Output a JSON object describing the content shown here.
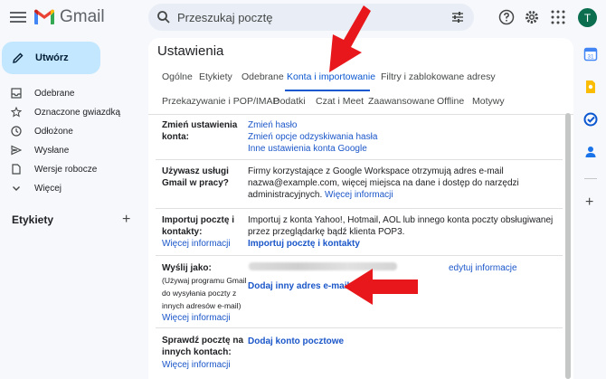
{
  "app": {
    "name": "Gmail",
    "avatar_letter": "T"
  },
  "search": {
    "placeholder": "Przeszukaj pocztę"
  },
  "sidebar": {
    "compose_label": "Utwórz",
    "items": [
      {
        "label": "Odebrane",
        "icon": "inbox-icon"
      },
      {
        "label": "Oznaczone gwiazdką",
        "icon": "star-icon"
      },
      {
        "label": "Odłożone",
        "icon": "clock-icon"
      },
      {
        "label": "Wysłane",
        "icon": "send-icon"
      },
      {
        "label": "Wersje robocze",
        "icon": "draft-icon"
      },
      {
        "label": "Więcej",
        "icon": "chevron-down-icon"
      }
    ],
    "labels_title": "Etykiety"
  },
  "settings": {
    "title": "Ustawienia",
    "tabs_row1": [
      "Ogólne",
      "Etykiety",
      "Odebrane",
      "Konta i importowanie",
      "Filtry i zablokowane adresy"
    ],
    "tabs_row2": [
      "Przekazywanie i POP/IMAP",
      "Dodatki",
      "Czat i Meet",
      "Zaawansowane",
      "Offline",
      "Motywy"
    ],
    "active_tab": "Konta i importowanie",
    "rows": {
      "change_account": {
        "label_line1": "Zmień ustawienia",
        "label_line2": "konta:",
        "links": [
          "Zmień hasło",
          "Zmień opcje odzyskiwania hasła",
          "Inne ustawienia konta Google"
        ]
      },
      "workspace": {
        "label_line1": "Używasz usługi",
        "label_line2": "Gmail w pracy?",
        "text_line1": "Firmy korzystające z Google Workspace otrzymują adres e-mail",
        "text_line2": "nazwa@example.com, więcej miejsca na dane i dostęp do narzędzi",
        "text_line3": "administracyjnych.",
        "link": "Więcej informacji"
      },
      "import": {
        "label_line1": "Importuj pocztę i",
        "label_line2": "kontakty:",
        "label_link": "Więcej informacji",
        "text_line1": "Importuj z konta Yahoo!, Hotmail, AOL lub innego konta poczty obsługiwanej",
        "text_line2": "przez przeglądarkę bądź klienta POP3.",
        "action_link": "Importuj pocztę i kontakty"
      },
      "send_as": {
        "label": "Wyślij jako:",
        "note_line1": "(Używaj programu Gmail",
        "note_line2": "do wysyłania poczty z",
        "note_line3": "innych adresów e-mail)",
        "label_link": "Więcej informacji",
        "edit_link": "edytuj informacje",
        "add_link": "Dodaj inny adres e-mail"
      },
      "check_mail": {
        "label_line1": "Sprawdź pocztę na",
        "label_line2": "innych kontach:",
        "label_link": "Więcej informacji",
        "action_link": "Dodaj konto pocztowe"
      }
    }
  },
  "colors": {
    "accent": "#0b57d0",
    "link": "#1a56c9",
    "compose_bg": "#c2e7ff",
    "annotation_arrow": "#e8171b"
  }
}
